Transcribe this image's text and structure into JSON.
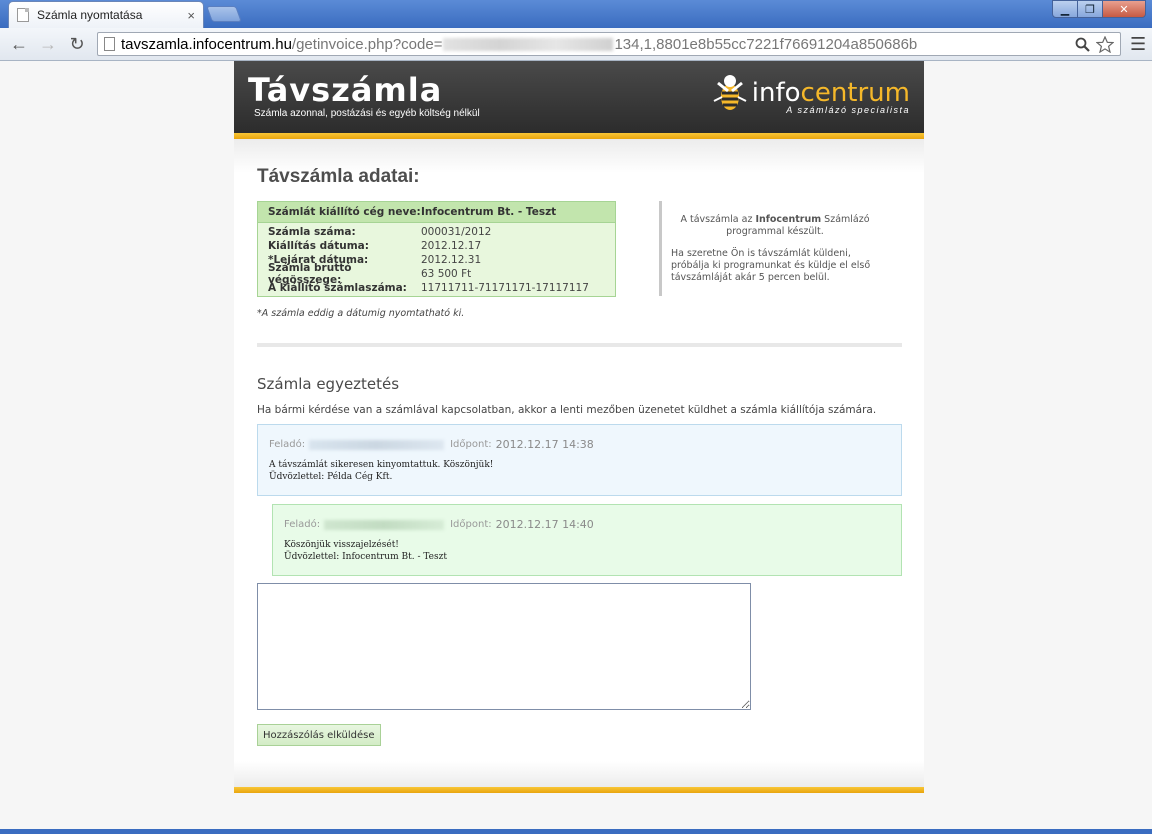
{
  "browser": {
    "tab_title": "Számla nyomtatása",
    "tab_close": "×",
    "url_host": "tavszamla.infocentrum.hu",
    "url_path_start": "/getinvoice.php?code=",
    "url_path_end": "134,1,8801e8b55cc7221f76691204a850686b",
    "window_minimize": "▁",
    "window_restore": "❐",
    "window_close": "✕"
  },
  "header": {
    "logo": "Távszámla",
    "tagline": "Számla azonnal, postázási és egyéb költség nélkül",
    "brand_prefix": "info",
    "brand_accent": "centrum",
    "brand_sub": "A számlázó specialista"
  },
  "invoice": {
    "title": "Távszámla adatai:",
    "head_label": "Számlát kiállító cég neve:",
    "head_value": "Infocentrum Bt. - Teszt",
    "rows": [
      {
        "label": "Számla száma:",
        "value": "000031/2012"
      },
      {
        "label": "Kiállítás dátuma:",
        "value": "2012.12.17"
      },
      {
        "label": "*Lejárat dátuma:",
        "value": "2012.12.31"
      },
      {
        "label": "Számla bruttó végösszege:",
        "value": "63 500 Ft"
      },
      {
        "label": "A kiállító számlaszáma:",
        "value": "11711711-71171171-17117117"
      }
    ],
    "footnote": "*A számla eddig a dátumig nyomtatható ki."
  },
  "info": {
    "line1_pre": "A távszámla az ",
    "line1_bold": "Infocentrum",
    "line1_post": " Számlázó programmal készült.",
    "line2": "Ha szeretne Ön is távszámlát küldeni, próbálja ki programunkat és küldje el első távszámláját akár 5 percen belül."
  },
  "reconcile": {
    "title": "Számla egyeztetés",
    "description": "Ha bármi kérdése van a számlával kapcsolatban, akkor a lenti mezőben üzenetet küldhet a számla kiállítója számára.",
    "sender_label": "Feladó:",
    "time_label": "Időpont:",
    "messages": [
      {
        "time": "2012.12.17 14:38",
        "line1": "A távszámlát sikeresen kinyomtattuk. Köszönjük!",
        "line2": "Üdvözlettel: Példa Cég Kft."
      },
      {
        "time": "2012.12.17 14:40",
        "line1": "Köszönjük visszajelzését!",
        "line2": "Üdvözlettel: Infocentrum Bt. - Teszt"
      }
    ],
    "reply_value": "",
    "submit_label": "Hozzászólás elküldése"
  },
  "colors": {
    "accent_yellow": "#f5b82a",
    "invoice_green": "#c2e5ad",
    "message_blue": "#eff7fd",
    "message_green": "#e8fbe8"
  }
}
